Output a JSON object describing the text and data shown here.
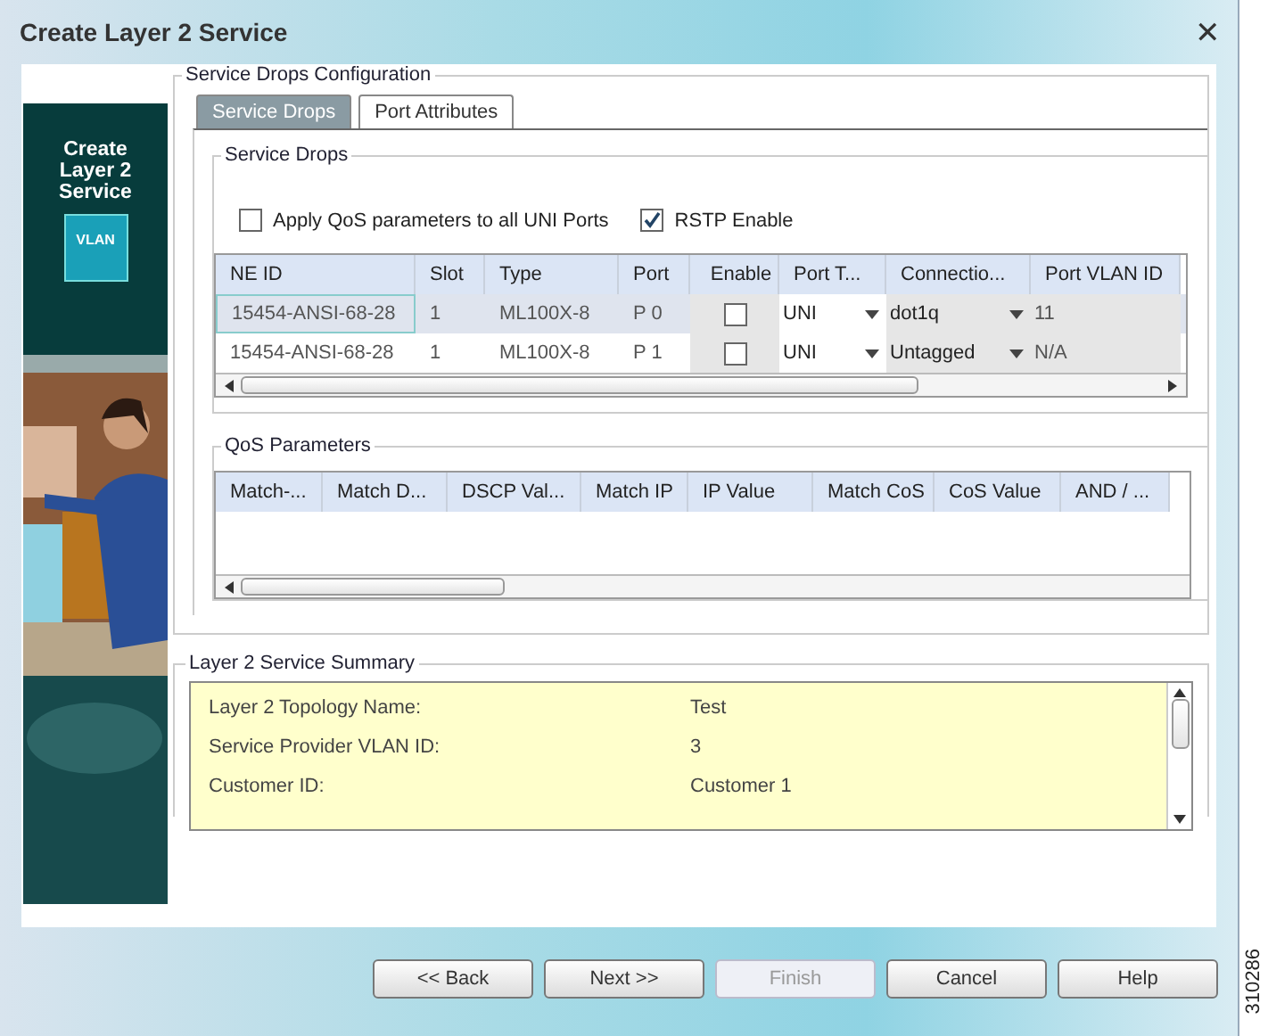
{
  "window": {
    "title": "Create Layer 2 Service",
    "close": "✕"
  },
  "banner": {
    "title": "Create Layer 2 Service",
    "badge": "VLAN"
  },
  "config": {
    "legend": "Service Drops Configuration",
    "tabs": [
      {
        "label": "Service Drops",
        "selected": true
      },
      {
        "label": "Port Attributes",
        "selected": false
      }
    ],
    "service_drops": {
      "legend": "Service Drops",
      "options": [
        {
          "label": "Apply QoS parameters to all UNI Ports",
          "checked": false
        },
        {
          "label": "RSTP Enable",
          "checked": true
        }
      ],
      "table": {
        "columns": [
          "NE ID",
          "Slot",
          "Type",
          "Port",
          "Enable",
          "Port T...",
          "Connectio...",
          "Port VLAN ID"
        ],
        "rows": [
          {
            "ne_id": "15454-ANSI-68-28",
            "slot": "1",
            "type": "ML100X-8",
            "port": "P 0",
            "enable": false,
            "port_type": "UNI",
            "connection": "dot1q",
            "vlan": "11",
            "selected": true
          },
          {
            "ne_id": "15454-ANSI-68-28",
            "slot": "1",
            "type": "ML100X-8",
            "port": "P 1",
            "enable": false,
            "port_type": "UNI",
            "connection": "Untagged",
            "vlan": "N/A",
            "selected": false
          }
        ]
      }
    },
    "qos": {
      "legend": "QoS Parameters",
      "columns": [
        "Match-...",
        "Match D...",
        "DSCP Val...",
        "Match IP",
        "IP Value",
        "Match CoS",
        "CoS Value",
        "AND / ..."
      ]
    }
  },
  "summary": {
    "legend": "Layer 2 Service Summary",
    "rows": [
      {
        "label": "Layer 2 Topology Name:",
        "value": "Test"
      },
      {
        "label": "Service Provider VLAN ID:",
        "value": "3"
      },
      {
        "label": "Customer ID:",
        "value": "Customer 1"
      }
    ]
  },
  "buttons": [
    {
      "label": "<< Back",
      "disabled": false
    },
    {
      "label": "Next >>",
      "disabled": false
    },
    {
      "label": "Finish",
      "disabled": true
    },
    {
      "label": "Cancel",
      "disabled": false
    },
    {
      "label": "Help",
      "disabled": false
    }
  ],
  "figure_number": "310286"
}
